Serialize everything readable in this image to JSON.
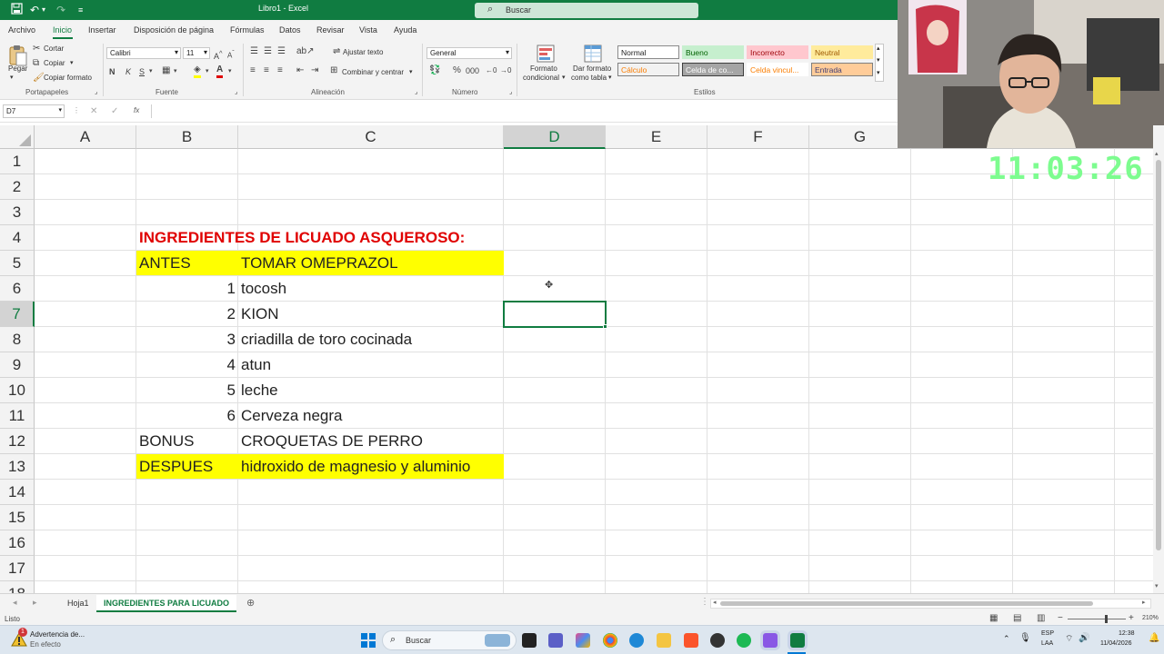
{
  "window": {
    "title": "Libro1  -  Excel",
    "search_placeholder": "Buscar"
  },
  "menu": [
    "Archivo",
    "Inicio",
    "Insertar",
    "Disposición de página",
    "Fórmulas",
    "Datos",
    "Revisar",
    "Vista",
    "Ayuda"
  ],
  "ribbon": {
    "clipboard": {
      "paste": "Pegar",
      "cut": "Cortar",
      "copy": "Copiar",
      "format_painter": "Copiar formato",
      "group": "Portapapeles"
    },
    "font": {
      "name": "Calibri",
      "size": "11",
      "group": "Fuente",
      "bold": "N",
      "italic": "K",
      "underline": "S"
    },
    "alignment": {
      "wrap": "Ajustar texto",
      "merge": "Combinar y centrar",
      "group": "Alineación"
    },
    "number": {
      "format": "General",
      "group": "Número"
    },
    "styles": {
      "conditional_line1": "Formato",
      "conditional_line2": "condicional",
      "table_line1": "Dar formato",
      "table_line2": "como tabla",
      "group": "Estilos",
      "cells": [
        {
          "label": "Normal",
          "bg": "#ffffff",
          "color": "#222222",
          "border": "#8a8a8a"
        },
        {
          "label": "Bueno",
          "bg": "#c6efce",
          "color": "#006100",
          "border": "#c6efce"
        },
        {
          "label": "Incorrecto",
          "bg": "#ffc7ce",
          "color": "#9c0006",
          "border": "#ffc7ce"
        },
        {
          "label": "Neutral",
          "bg": "#ffeb9c",
          "color": "#9c5700",
          "border": "#ffeb9c"
        },
        {
          "label": "Cálculo",
          "bg": "#f2f2f2",
          "color": "#fa7d00",
          "border": "#7f7f7f"
        },
        {
          "label": "Celda de co...",
          "bg": "#a5a5a5",
          "color": "#ffffff",
          "border": "#3f3f3f"
        },
        {
          "label": "Celda vincul...",
          "bg": "#ffffff",
          "color": "#fa7d00",
          "border": "#ffffff"
        },
        {
          "label": "Entrada",
          "bg": "#ffcc99",
          "color": "#3f3f76",
          "border": "#7f7f7f"
        }
      ]
    }
  },
  "formula_bar": {
    "name_box": "D7",
    "fx": "fx",
    "value": ""
  },
  "columns": [
    "A",
    "B",
    "C",
    "D",
    "E",
    "F",
    "G"
  ],
  "rows": [
    "1",
    "2",
    "3",
    "4",
    "5",
    "6",
    "7",
    "8",
    "9",
    "10",
    "11",
    "12",
    "13",
    "14",
    "15",
    "16",
    "17",
    "18"
  ],
  "cells": {
    "B4": "INGREDIENTES DE LICUADO ASQUEROSO:",
    "B5": "ANTES",
    "C5": "TOMAR OMEPRAZOL",
    "B6": "1",
    "C6": "tocosh",
    "B7": "2",
    "C7": "KION",
    "B8": "3",
    "C8": "criadilla de toro cocinada",
    "B9": "4",
    "C9": "atun",
    "B10": "5",
    "C10": "leche",
    "B11": "6",
    "C11": "Cerveza negra",
    "B12": "BONUS",
    "C12": "CROQUETAS DE PERRO",
    "B13": "DESPUES",
    "C13": "hidroxido de magnesio y aluminio"
  },
  "selected_cell": "D7",
  "clock_overlay": "11:03:26",
  "sheets": [
    "Hoja1",
    "INGREDIENTES PARA LICUADO"
  ],
  "status": {
    "ready": "Listo",
    "zoom": "210%"
  },
  "taskbar": {
    "notification_title": "Advertencia de...",
    "notification_sub": "En efecto",
    "search": "Buscar",
    "lang1": "ESP",
    "lang2": "LAA",
    "time": "12:38",
    "date": "11/04/2026",
    "badge": "1"
  },
  "colors": {
    "excel_green": "#107c41",
    "highlight": "#ffff00",
    "title_red": "#e00000",
    "clock": "#7dfc8f"
  }
}
